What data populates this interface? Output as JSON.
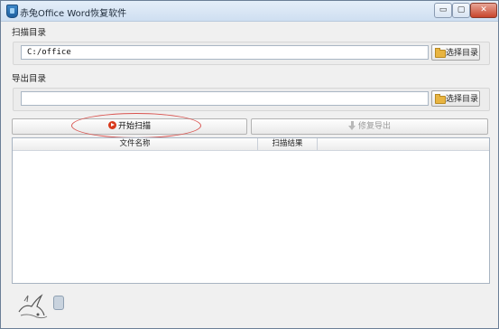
{
  "window": {
    "title": "赤兔Office Word恢复软件",
    "controls": {
      "minimize": "▭",
      "maximize": "▢",
      "close": "✕"
    }
  },
  "scan_dir": {
    "label": "扫描目录",
    "value": "C:/office",
    "choose_label": "选择目录"
  },
  "export_dir": {
    "label": "导出目录",
    "value": "",
    "choose_label": "选择目录"
  },
  "actions": {
    "start_scan_label": "开始扫描",
    "repair_export_label": "修复导出"
  },
  "results_table": {
    "columns": [
      "文件名称",
      "扫描结果"
    ],
    "rows": []
  },
  "colors": {
    "accent_red": "#d8391b",
    "highlight": "#d9534f",
    "folder": "#e8b441"
  },
  "icons": [
    "app-icon",
    "folder-icon",
    "play-icon",
    "download-icon",
    "rabbit-logo"
  ]
}
